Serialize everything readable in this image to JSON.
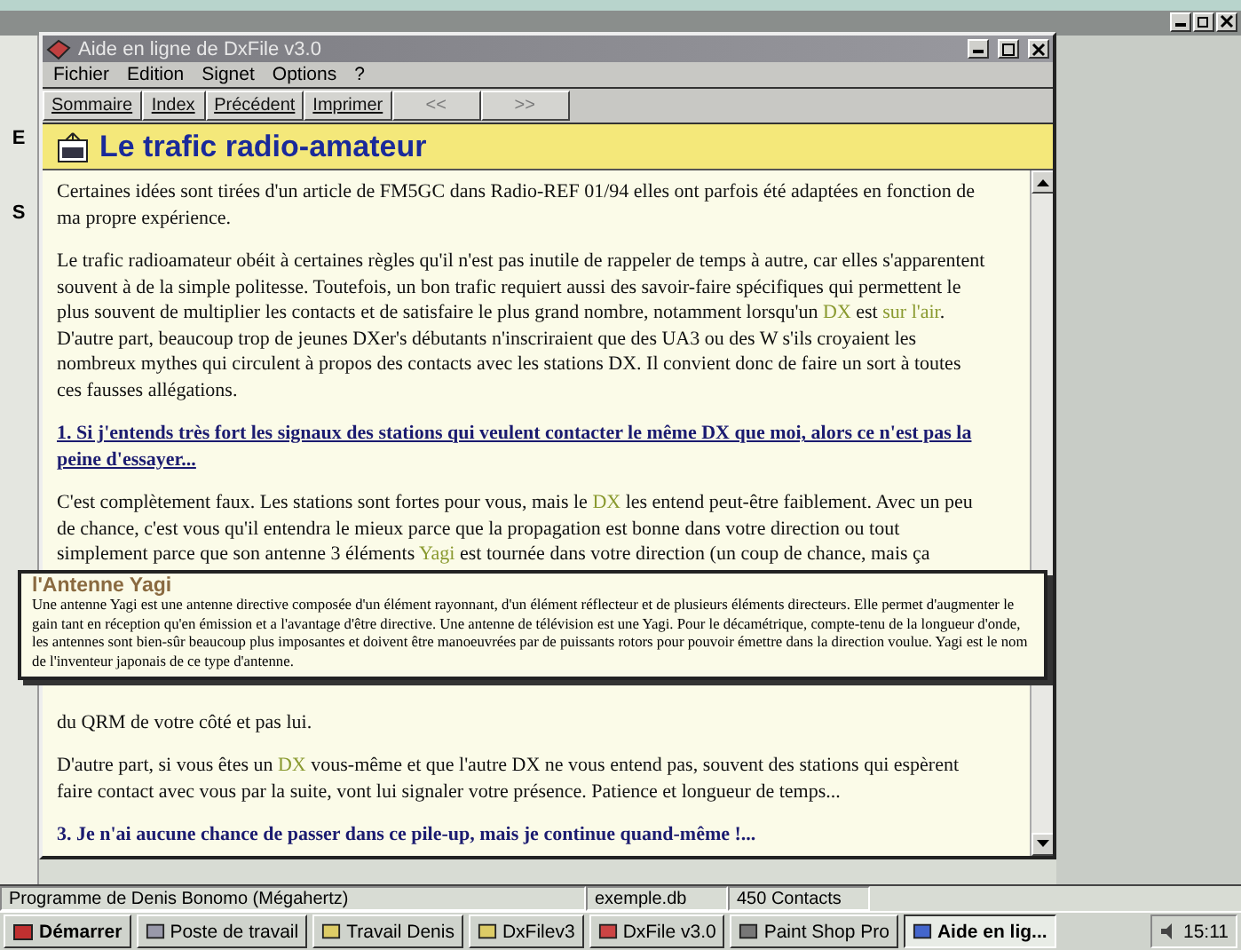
{
  "parent_window": {
    "menu_fragments": [
      "E",
      "S"
    ]
  },
  "help_window": {
    "title": "Aide en ligne de DxFile v3.0",
    "menu": [
      "Fichier",
      "Edition",
      "Signet",
      "Options",
      "?"
    ],
    "buttons": [
      {
        "label": "Sommaire",
        "disabled": false
      },
      {
        "label": "Index",
        "disabled": false
      },
      {
        "label": "Précédent",
        "disabled": false
      },
      {
        "label": "Imprimer",
        "disabled": false
      },
      {
        "label": "<<",
        "disabled": true
      },
      {
        "label": ">>",
        "disabled": true
      }
    ],
    "heading": "Le trafic radio-amateur",
    "content": [
      {
        "kind": "text",
        "segments": [
          {
            "text": "Certaines idées sont tirées d'un article de FM5GC dans Radio-REF 01/94 elles ont parfois été adaptées en fonction de ma propre expérience.",
            "kind": "text"
          }
        ]
      },
      {
        "kind": "text",
        "segments": [
          {
            "text": "Le trafic radioamateur obéit à certaines règles qu'il n'est pas inutile de rappeler de temps à autre, car elles s'apparentent souvent à de la simple politesse. Toutefois, un bon trafic requiert aussi des savoir-faire spécifiques qui permettent le plus souvent de multiplier les contacts et de satisfaire le plus grand nombre, notamment lorsqu'un ",
            "kind": "text"
          },
          {
            "text": "DX",
            "kind": "link"
          },
          {
            "text": " est ",
            "kind": "text"
          },
          {
            "text": "sur l'air",
            "kind": "link"
          },
          {
            "text": ". D'autre part, beaucoup trop de jeunes DXer's débutants n'inscriraient que des UA3 ou des W s'ils croyaient les nombreux mythes qui circulent à propos des contacts avec les stations DX. Il convient donc de faire un sort à toutes ces fausses allégations.",
            "kind": "text"
          }
        ]
      },
      {
        "kind": "question",
        "segments": [
          {
            "text": "1. Si j'entends très fort les signaux des stations qui veulent contacter le même DX que moi, alors ce n'est pas la peine d'essayer...",
            "kind": "text"
          }
        ]
      },
      {
        "kind": "text",
        "segments": [
          {
            "text": "C'est complètement faux. Les stations sont fortes pour vous, mais le ",
            "kind": "text"
          },
          {
            "text": "DX",
            "kind": "link"
          },
          {
            "text": " les entend peut-être faiblement. Avec un peu de chance, c'est vous qu'il entendra le mieux parce que la propagation est bonne dans votre direction ou tout simplement parce que son antenne 3 éléments ",
            "kind": "text"
          },
          {
            "text": "Yagi",
            "kind": "link"
          },
          {
            "text": " est tournée dans votre direction (un coup de chance, mais ça",
            "kind": "text"
          }
        ]
      },
      {
        "kind": "covered",
        "segments": [
          {
            "text": "du QRM de votre côté et pas lui.",
            "kind": "text"
          }
        ]
      },
      {
        "kind": "text",
        "segments": [
          {
            "text": "D'autre part, si vous êtes un ",
            "kind": "text"
          },
          {
            "text": "DX",
            "kind": "link"
          },
          {
            "text": " vous-même et que l'autre DX ne vous entend pas, souvent des stations qui espèrent faire contact avec vous par la suite, vont lui signaler votre présence. Patience et longueur de temps...",
            "kind": "text"
          }
        ]
      },
      {
        "kind": "heading",
        "segments": [
          {
            "text": "3. Je n'ai aucune chance de passer dans ce pile-up, mais je continue quand-même !...",
            "kind": "text"
          }
        ]
      }
    ],
    "popup": {
      "title": "l'Antenne Yagi",
      "text": "Une antenne Yagi est une antenne directive composée d'un élément rayonnant, d'un élément réflecteur et de plusieurs éléments directeurs. Elle permet d'augmenter le gain tant en réception qu'en émission et a l'avantage d'être directive. Une antenne de télévision est une Yagi. Pour le décamétrique, compte-tenu de la longueur d'onde, les antennes sont bien-sûr beaucoup plus imposantes et doivent être manoeuvrées par de puissants rotors pour pouvoir émettre dans la direction voulue. Yagi est le nom de l'inventeur japonais de ce type d'antenne."
    }
  },
  "status_bar": [
    "Programme de Denis Bonomo (Mégahertz)",
    "exemple.db",
    "450 Contacts"
  ],
  "taskbar": {
    "start": "Démarrer",
    "items": [
      {
        "label": "Poste de travail",
        "selected": false
      },
      {
        "label": "Travail Denis",
        "selected": false
      },
      {
        "label": "DxFilev3",
        "selected": false
      },
      {
        "label": "DxFile v3.0",
        "selected": false
      },
      {
        "label": "Paint Shop Pro",
        "selected": false
      },
      {
        "label": "Aide en lig...",
        "selected": true
      }
    ],
    "clock": "15:11"
  }
}
